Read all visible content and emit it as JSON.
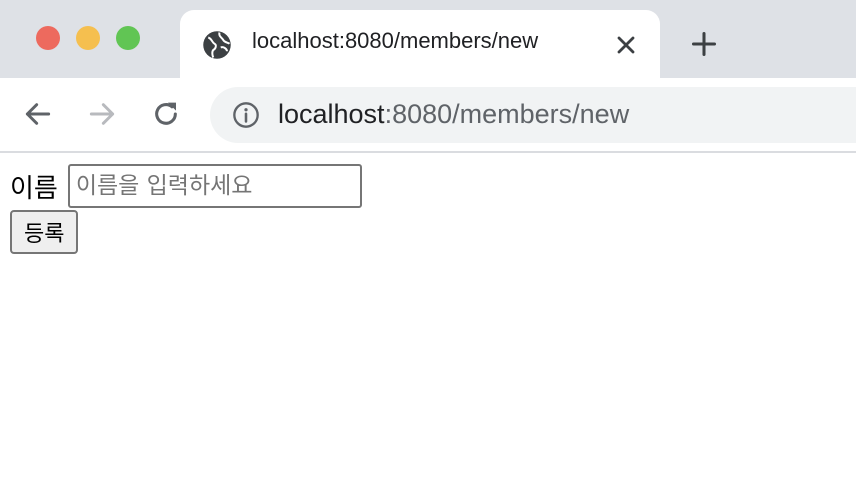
{
  "browser": {
    "tab": {
      "title": "localhost:8080/members/new",
      "favicon": "globe-icon"
    },
    "address_bar": {
      "host": "localhost",
      "rest": ":8080/members/new",
      "security_icon": "info-icon"
    },
    "controls": {
      "back_icon": "arrow-left-icon",
      "forward_icon": "arrow-right-icon",
      "reload_icon": "reload-icon",
      "close_tab_icon": "close-icon",
      "new_tab_icon": "plus-icon"
    },
    "colors": {
      "tabbar_bg": "#dee1e6",
      "omnibox_bg": "#f1f3f4",
      "close": "#ed6a5e",
      "minimize": "#f5bf4f",
      "zoom": "#61c554"
    }
  },
  "form": {
    "name_label": "이름",
    "name_value": "",
    "name_placeholder": "이름을 입력하세요",
    "submit_label": "등록"
  }
}
